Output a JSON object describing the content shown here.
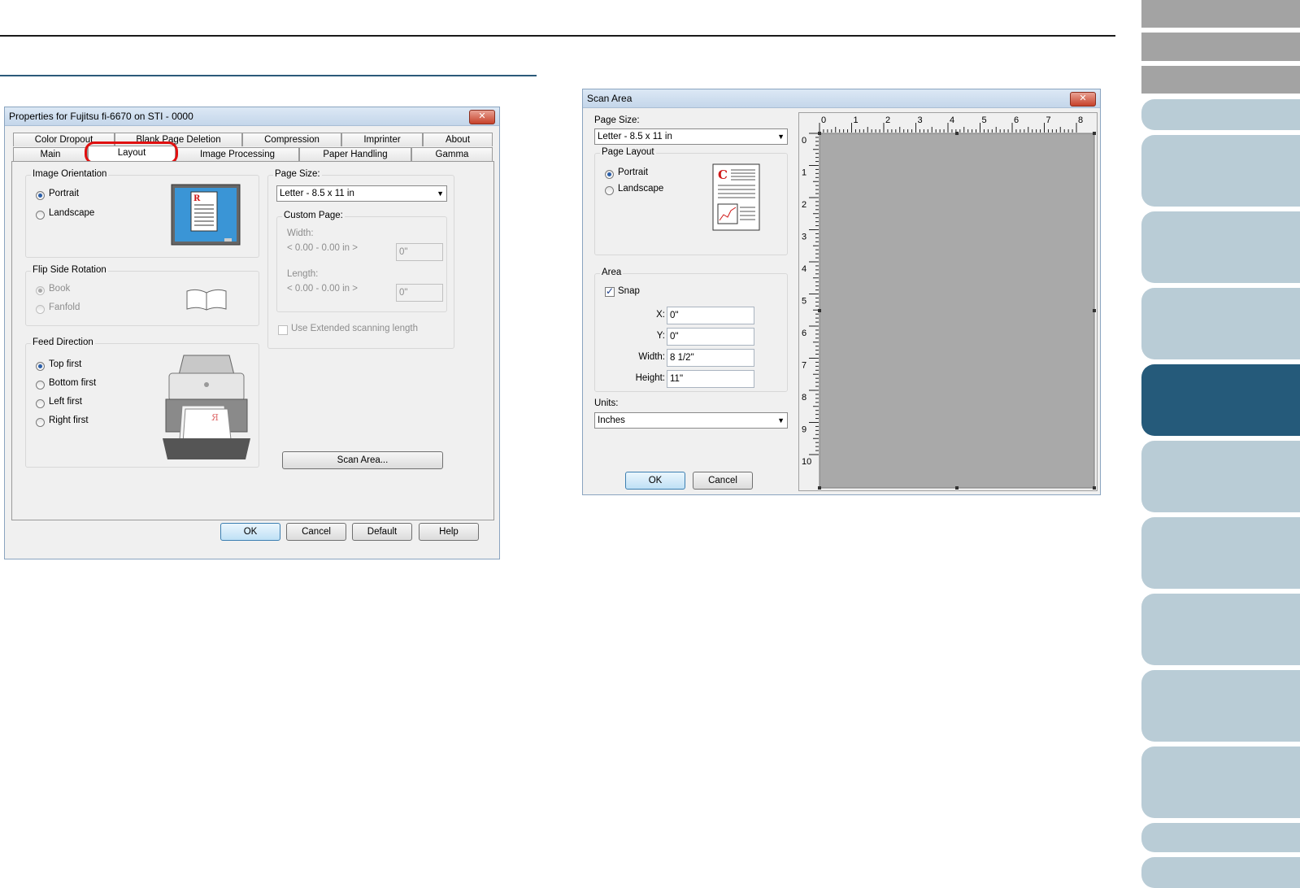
{
  "properties_dialog": {
    "title": "Properties for Fujitsu fi-6670 on STI - 0000",
    "close_glyph": "✕",
    "tabs_back": [
      "Color Dropout",
      "Blank Page Deletion",
      "Compression",
      "Imprinter",
      "About"
    ],
    "tabs_front": [
      "Main",
      "Layout",
      "Image Processing",
      "Paper Handling",
      "Gamma"
    ],
    "selected_tab": "Layout",
    "image_orientation": {
      "label": "Image Orientation",
      "options": [
        "Portrait",
        "Landscape"
      ],
      "selected": "Portrait"
    },
    "flip_side_rotation": {
      "label": "Flip Side Rotation",
      "options": [
        "Book",
        "Fanfold"
      ],
      "selected": "Book"
    },
    "feed_direction": {
      "label": "Feed Direction",
      "options": [
        "Top first",
        "Bottom first",
        "Left first",
        "Right first"
      ],
      "selected": "Top first"
    },
    "page_size": {
      "label": "Page Size:",
      "value": "Letter - 8.5 x 11 in"
    },
    "custom_page": {
      "label": "Custom Page:",
      "width_label": "Width:",
      "width_range": "< 0.00 - 0.00 in >",
      "width_value": "0\"",
      "length_label": "Length:",
      "length_range": "< 0.00 - 0.00 in >",
      "length_value": "0\""
    },
    "extended_scanning": "Use Extended scanning length",
    "scan_area_button": "Scan Area...",
    "buttons": {
      "ok": "OK",
      "cancel": "Cancel",
      "default": "Default",
      "help": "Help"
    }
  },
  "scan_area_dialog": {
    "title": "Scan Area",
    "close_glyph": "✕",
    "page_size_label": "Page Size:",
    "page_size_value": "Letter - 8.5 x 11 in",
    "page_layout": {
      "label": "Page Layout",
      "options": [
        "Portrait",
        "Landscape"
      ],
      "selected": "Portrait"
    },
    "area": {
      "label": "Area",
      "snap_label": "Snap",
      "snap_checked": true,
      "x_label": "X:",
      "x_value": "0\"",
      "y_label": "Y:",
      "y_value": "0\"",
      "width_label": "Width:",
      "width_value": "8 1/2\"",
      "height_label": "Height:",
      "height_value": "11\""
    },
    "units_label": "Units:",
    "units_value": "Inches",
    "buttons": {
      "ok": "OK",
      "cancel": "Cancel"
    },
    "ruler_top": [
      "0",
      "1",
      "2",
      "3",
      "4",
      "5",
      "6",
      "7",
      "8"
    ],
    "ruler_left": [
      "0",
      "1",
      "2",
      "3",
      "4",
      "5",
      "6",
      "7",
      "8",
      "9",
      "10"
    ]
  },
  "colors": {
    "nav_tab": "#b9ccd6",
    "nav_active": "#255a7a",
    "nav_gray": "#a3a3a3",
    "highlight_ring": "#e01010"
  }
}
